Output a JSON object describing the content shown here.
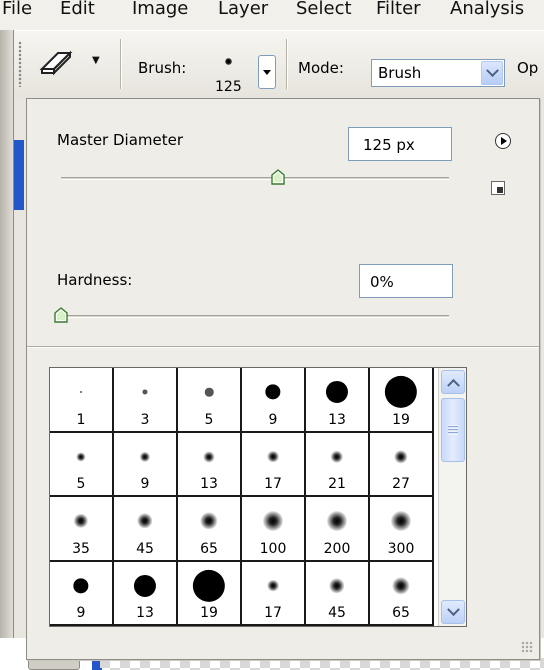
{
  "menu": [
    "File",
    "Edit",
    "Image",
    "Layer",
    "Select",
    "Filter",
    "Analysis"
  ],
  "options_bar": {
    "tool_icon": "eraser-icon",
    "brush_label": "Brush:",
    "brush_size": "125",
    "mode_label": "Mode:",
    "mode_value": "Brush",
    "opacity_label": "Op"
  },
  "brush_picker": {
    "master_diameter_label": "Master Diameter",
    "master_diameter_value": "125 px",
    "master_diameter_level": 0.56,
    "hardness_label": "Hardness:",
    "hardness_value": "0%",
    "hardness_level": 0.0,
    "flyout_icon": "flyout-menu-icon",
    "new_preset_icon": "new-preset-icon",
    "presets": [
      {
        "size": "1",
        "type": "hard"
      },
      {
        "size": "3",
        "type": "hard"
      },
      {
        "size": "5",
        "type": "hard"
      },
      {
        "size": "9",
        "type": "hard"
      },
      {
        "size": "13",
        "type": "hard"
      },
      {
        "size": "19",
        "type": "hard"
      },
      {
        "size": "5",
        "type": "soft"
      },
      {
        "size": "9",
        "type": "soft"
      },
      {
        "size": "13",
        "type": "soft"
      },
      {
        "size": "17",
        "type": "soft"
      },
      {
        "size": "21",
        "type": "soft"
      },
      {
        "size": "27",
        "type": "soft"
      },
      {
        "size": "35",
        "type": "soft"
      },
      {
        "size": "45",
        "type": "soft"
      },
      {
        "size": "65",
        "type": "soft"
      },
      {
        "size": "100",
        "type": "soft"
      },
      {
        "size": "200",
        "type": "soft"
      },
      {
        "size": "300",
        "type": "soft"
      },
      {
        "size": "9",
        "type": "hard"
      },
      {
        "size": "13",
        "type": "hard"
      },
      {
        "size": "19",
        "type": "hard"
      },
      {
        "size": "17",
        "type": "soft"
      },
      {
        "size": "45",
        "type": "soft"
      },
      {
        "size": "65",
        "type": "soft"
      }
    ]
  }
}
